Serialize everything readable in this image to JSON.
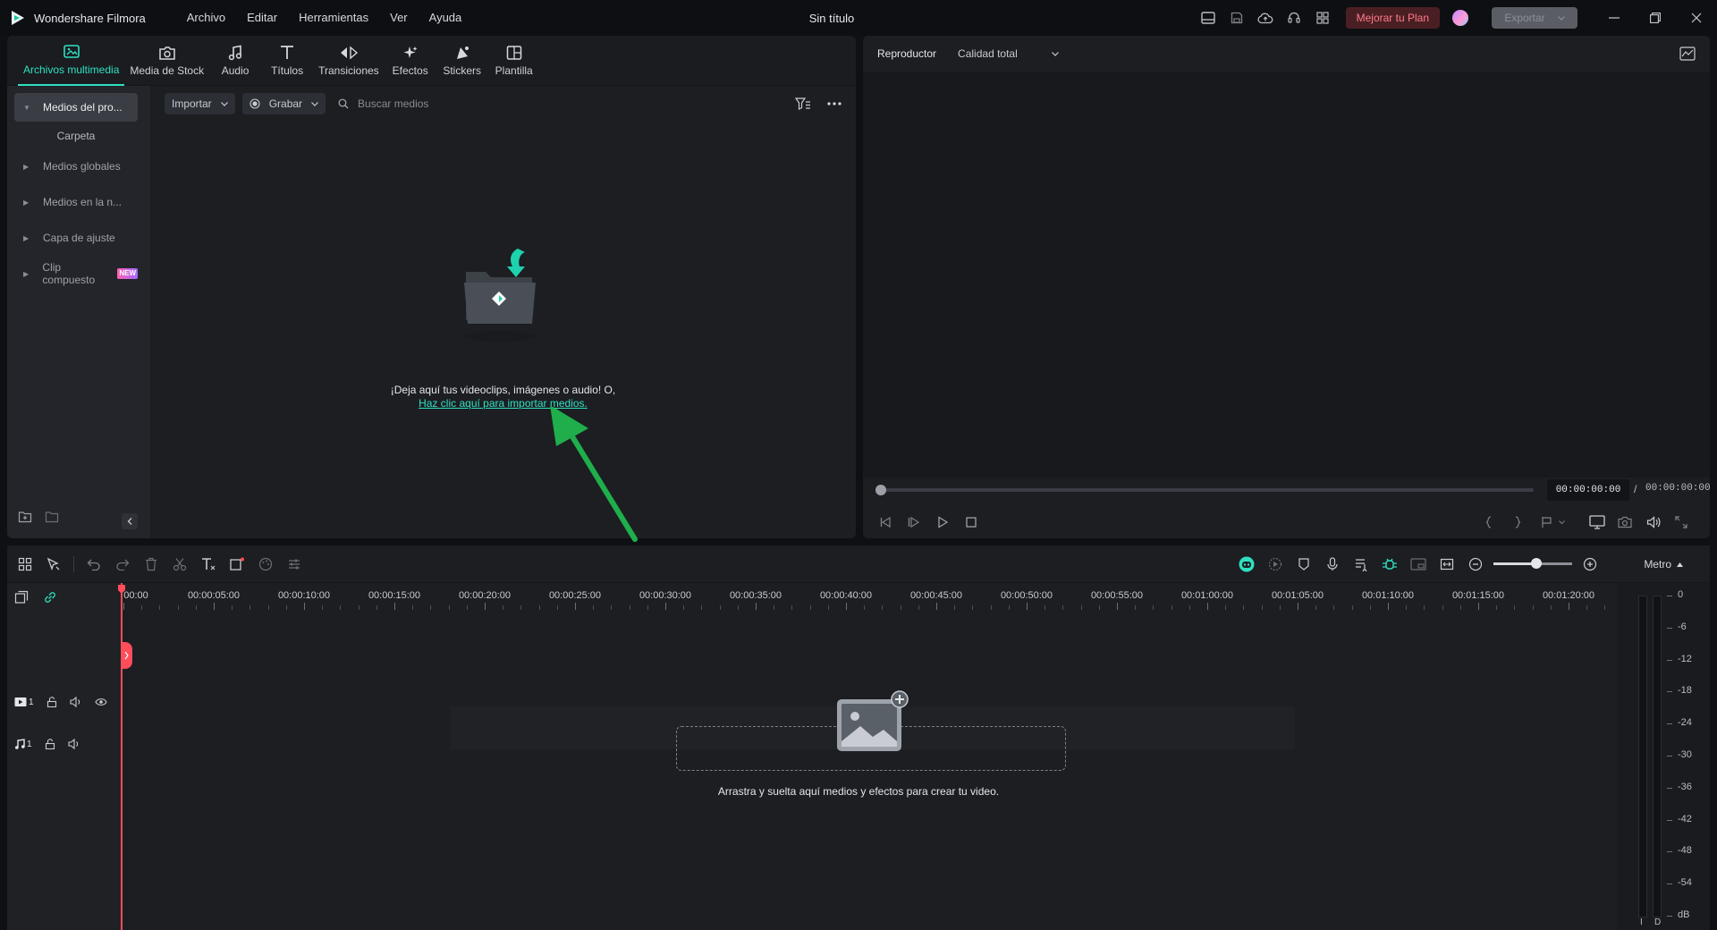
{
  "app": {
    "name": "Wondershare Filmora",
    "document_title": "Sin título",
    "menu": [
      "Archivo",
      "Editar",
      "Herramientas",
      "Ver",
      "Ayuda"
    ],
    "upgrade_label": "Mejorar tu Plan",
    "export_label": "Exportar"
  },
  "media_panel": {
    "tabs": [
      {
        "label": "Archivos multimedia",
        "icon": "media-files-icon",
        "active": true
      },
      {
        "label": "Media de Stock",
        "icon": "stock-media-icon",
        "active": false
      },
      {
        "label": "Audio",
        "icon": "music-note-icon",
        "active": false
      },
      {
        "label": "Títulos",
        "icon": "title-text-icon",
        "active": false
      },
      {
        "label": "Transiciones",
        "icon": "transition-arrows-icon",
        "active": false
      },
      {
        "label": "Efectos",
        "icon": "effects-sparkle-icon",
        "active": false
      },
      {
        "label": "Stickers",
        "icon": "sticker-icon",
        "active": false
      },
      {
        "label": "Plantilla",
        "icon": "template-grid-icon",
        "active": false
      }
    ],
    "sidebar": {
      "project_media": "Medios del pro...",
      "folder": "Carpeta",
      "items": [
        "Medios globales",
        "Medios en la n...",
        "Capa de ajuste",
        "Clip compuesto"
      ],
      "new_badge": "NEW"
    },
    "toolbar": {
      "import_label": "Importar",
      "record_label": "Grabar",
      "search_placeholder": "Buscar medios"
    },
    "drop": {
      "message": "¡Deja aquí tus videoclips, imágenes o audio! O,",
      "link": "Haz clic aquí para importar medios."
    }
  },
  "player": {
    "title": "Reproductor",
    "quality": "Calidad total",
    "current_time": "00:00:00:00",
    "separator": "/",
    "total_time": "00:00:00:00",
    "progress": 0
  },
  "timeline": {
    "meter_label": "Metro",
    "zoom_level": 0.55,
    "ruler_labels": [
      "00:00",
      "00:00:05:00",
      "00:00:10:00",
      "00:00:15:00",
      "00:00:20:00",
      "00:00:25:00",
      "00:00:30:00",
      "00:00:35:00",
      "00:00:40:00",
      "00:00:45:00",
      "00:00:50:00",
      "00:00:55:00",
      "00:01:00:00",
      "00:01:05:00",
      "00:01:10:00",
      "00:01:15:00",
      "00:01:20:00"
    ],
    "tracks": [
      {
        "type": "video",
        "number": "1"
      },
      {
        "type": "audio",
        "number": "1"
      }
    ],
    "hint": "Arrastra y suelta aquí medios y efectos para crear tu video.",
    "vu_scale": [
      "0",
      "-6",
      "-12",
      "-18",
      "-24",
      "-30",
      "-36",
      "-42",
      "-48",
      "-54",
      "dB"
    ],
    "vu_channels": [
      "I",
      "D"
    ]
  },
  "colors": {
    "accent": "#2fe0c0",
    "playhead": "#ff4d5a",
    "annotation_arrow": "#1fae4b"
  }
}
